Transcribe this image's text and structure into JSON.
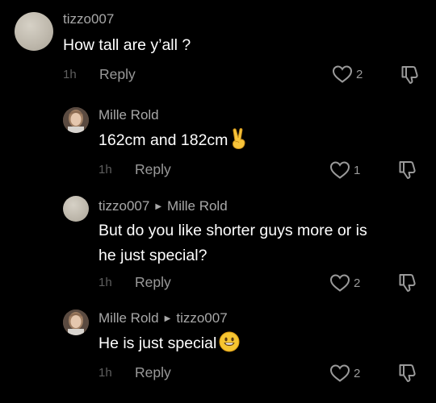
{
  "comments": [
    {
      "author": "tizzo007",
      "reply_to": "",
      "text": "How tall are y’all ?",
      "time": "1h",
      "reply_label": "Reply",
      "likes": "2",
      "avatar": "gray-avatar"
    },
    {
      "author": "Mille Rold",
      "reply_to": "",
      "text": "162cm and 182cm",
      "emoji": "victory-hand-emoji",
      "time": "1h",
      "reply_label": "Reply",
      "likes": "1",
      "avatar": "photo-avatar"
    },
    {
      "author": "tizzo007",
      "reply_to": "Mille Rold",
      "text_line1": "But do you like shorter guys more or is",
      "text_line2": "he just special?",
      "time": "1h",
      "reply_label": "Reply",
      "likes": "2",
      "avatar": "gray-avatar"
    },
    {
      "author": "Mille Rold",
      "reply_to": "tizzo007",
      "text": "He is just special",
      "emoji": "smiling-face-emoji",
      "time": "1h",
      "reply_label": "Reply",
      "likes": "2",
      "avatar": "photo-avatar"
    }
  ],
  "colors": {
    "background": "#000000",
    "text": "#ffffff",
    "author": "#a8a8a8",
    "meta": "#9a9a9a",
    "time": "#5f5f5f"
  },
  "icons": [
    "heart-outline-icon",
    "thumbs-down-outline-icon",
    "reply-arrow-icon"
  ]
}
